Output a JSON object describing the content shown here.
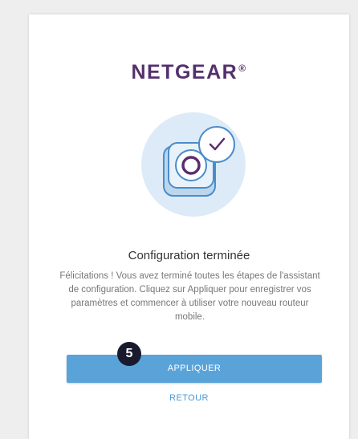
{
  "brand": {
    "logo_text": "NETGEAR",
    "logo_mark": "®",
    "color": "#54306c"
  },
  "hero": {
    "icon": "router-check-icon"
  },
  "content": {
    "title": "Configuration terminée",
    "description": "Félicitations ! Vous avez terminé toutes les étapes de l'assistant de configuration. Cliquez sur Appliquer pour enregistrer vos paramètres et commencer à utiliser votre nouveau routeur mobile."
  },
  "actions": {
    "apply_label": "APPLIQUER",
    "back_label": "RETOUR",
    "accent": "#5aa3d9"
  },
  "annotation": {
    "step_number": "5"
  }
}
